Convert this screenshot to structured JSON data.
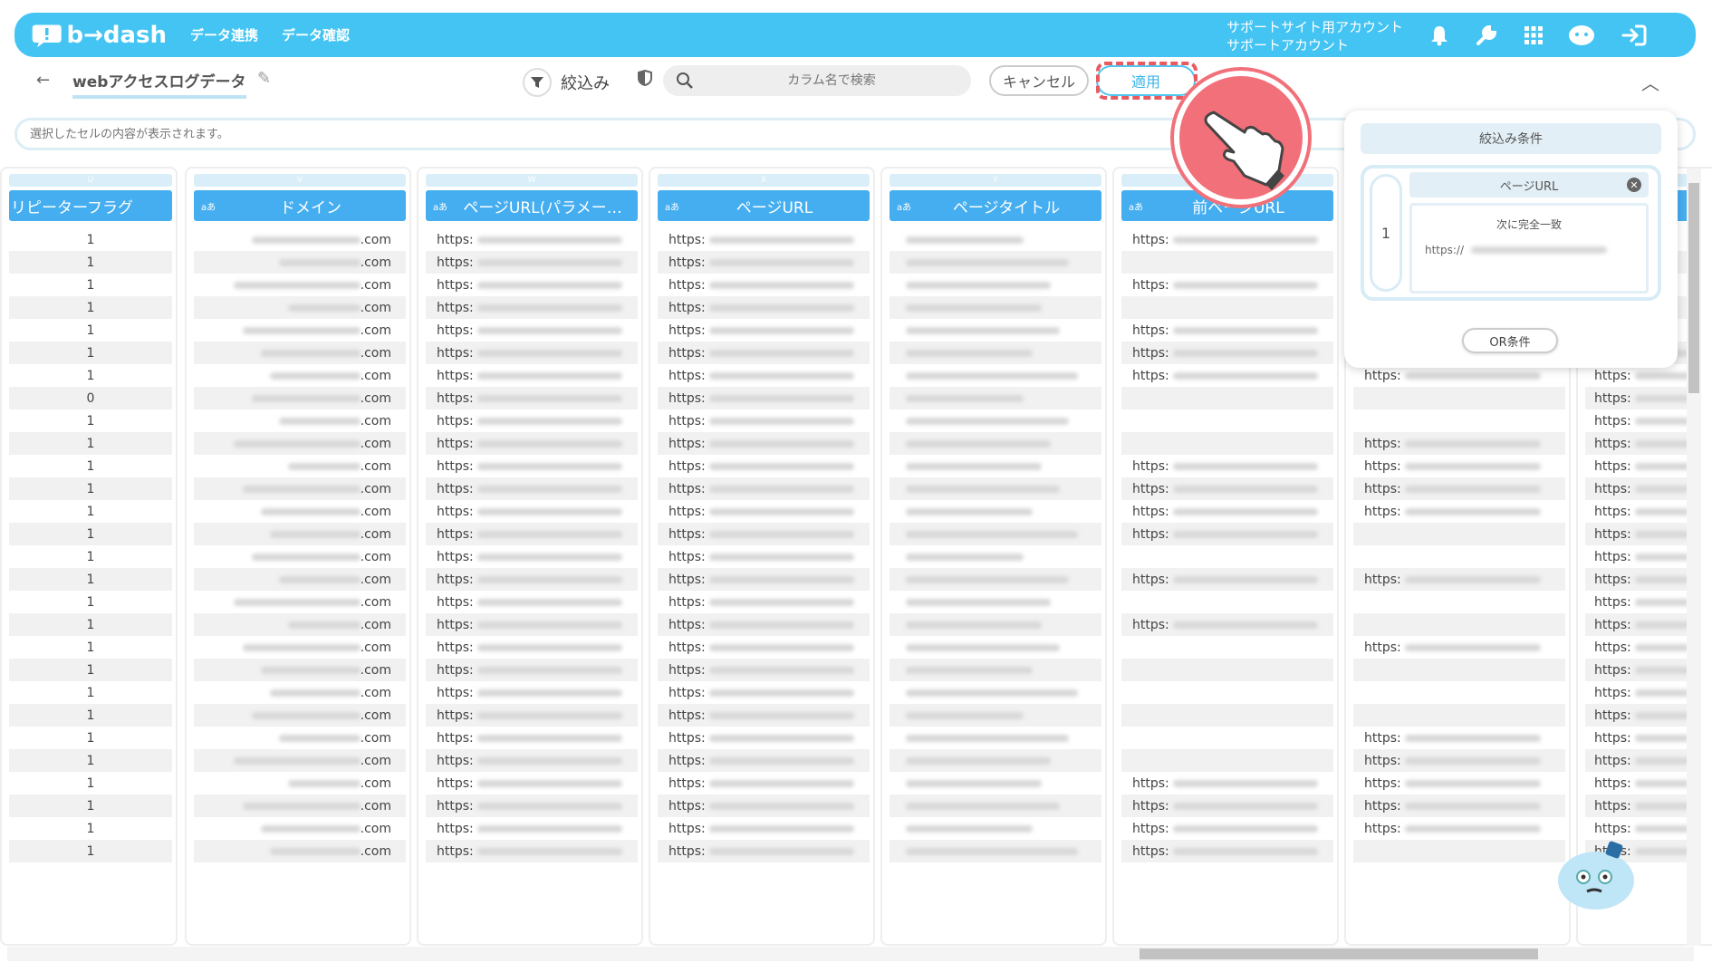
{
  "header": {
    "logo_text": "b→dash",
    "nav": [
      "データ連携",
      "データ確認"
    ],
    "account_line1": "サポートサイト用アカウント",
    "account_line2": "サポートアカウント",
    "accent_color": "#43c4f3"
  },
  "toolbar": {
    "title": "webアクセスログデータ",
    "filter_label": "絞込み",
    "search_placeholder": "カラム名で検索",
    "cancel_label": "キャンセル",
    "apply_label": "適用"
  },
  "cellbar": {
    "placeholder": "選択したセルの内容が表示されます。"
  },
  "columns": [
    {
      "letter": "U",
      "type": "",
      "name": "リピーターフラグ"
    },
    {
      "letter": "V",
      "type": "aあ",
      "name": "ドメイン"
    },
    {
      "letter": "W",
      "type": "aあ",
      "name": "ページURL(パラメー…"
    },
    {
      "letter": "X",
      "type": "aあ",
      "name": "ページURL"
    },
    {
      "letter": "Y",
      "type": "aあ",
      "name": "ページタイトル"
    },
    {
      "letter": "",
      "type": "aあ",
      "name": "前ページURL"
    }
  ],
  "rows": {
    "repeater_flags": [
      "1",
      "1",
      "1",
      "1",
      "1",
      "1",
      "1",
      "0",
      "1",
      "1",
      "1",
      "1",
      "1",
      "1",
      "1",
      "1",
      "1",
      "1",
      "1",
      "1",
      "1",
      "1",
      "1",
      "1",
      "1",
      "1",
      "1",
      "1"
    ],
    "domain_suffix": ".com",
    "url_prefix": "https:"
  },
  "popup": {
    "title": "絞込み条件",
    "condition_number": "1",
    "field": "ページURL",
    "operator": "次に完全一致",
    "value_prefix": "https://",
    "or_label": "OR条件"
  }
}
